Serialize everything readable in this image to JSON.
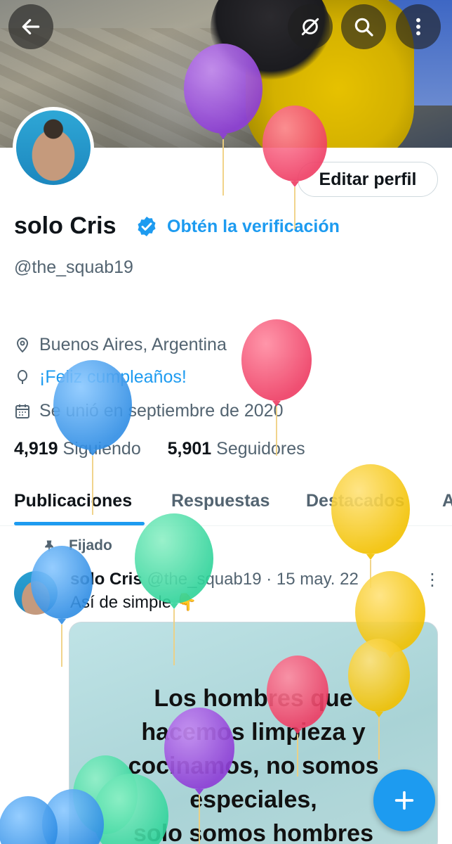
{
  "header": {
    "back_icon": "arrow-left-icon",
    "icons": [
      "grok-icon",
      "search-icon",
      "more-vertical-icon"
    ]
  },
  "profile": {
    "edit_button": "Editar perfil",
    "name": "solo Cris",
    "verify_link": "Obtén la verificación",
    "handle": "@the_squab19",
    "location": "Buenos Aires, Argentina",
    "birthday": "¡Feliz cumpleaños!",
    "joined": "Se unió en septiembre de 2020",
    "following_count": "4,919",
    "following_label": "Siguiendo",
    "followers_count": "5,901",
    "followers_label": "Seguidores"
  },
  "tabs": [
    {
      "label": "Publicaciones"
    },
    {
      "label": "Respuestas"
    },
    {
      "label": "Destacados"
    },
    {
      "label": "A"
    }
  ],
  "post": {
    "pinned_label": "Fijado",
    "author_name": "solo Cris",
    "author_handle_date": "@the_squab19 · 15 may. 22",
    "text": "Así de simple 👇",
    "image_text": [
      "Los hombres que",
      "hacemos limpieza y",
      "cocinamos, no somos",
      "especiales,",
      "solo somos hombres"
    ]
  },
  "colors": {
    "accent": "#1d9bf0",
    "text": "#0f1419",
    "secondary": "#536471"
  }
}
